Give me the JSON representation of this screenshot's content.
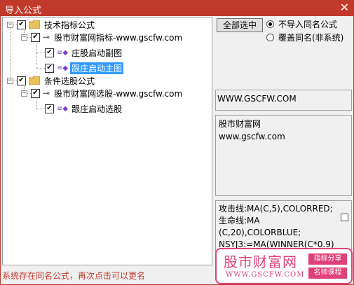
{
  "window": {
    "title": "导入公式",
    "close_glyph": "✕"
  },
  "tree": {
    "group1": {
      "label": "技术指标公式",
      "checked": true
    },
    "group1_child": {
      "label": "股市财富网指标-www.gscfw.com"
    },
    "group1_item1": {
      "label": "庄股启动副图"
    },
    "group1_item2": {
      "label": "跟庄启动主图"
    },
    "group2": {
      "label": "条件选股公式"
    },
    "group2_child": {
      "label": "股市财富网选股-www.gscfw.com"
    },
    "group2_item1": {
      "label": "跟庄启动选股"
    },
    "expander_glyph": "−",
    "check_glyph": "✔"
  },
  "options": {
    "select_all_label": "全部选中",
    "radio_no_import": "不导入同名公式",
    "radio_overwrite": "覆盖同名(非系统)"
  },
  "info": {
    "url": "WWW.GSCFW.COM",
    "desc_line1": "股市财富网",
    "desc_line2": "www.gscfw.com",
    "code_lines": [
      "攻击线:MA(C,5),COLORRED;",
      "生命线:MA",
      "(C,20),COLORBLUE;",
      "NSYJ3:=MA(WINNER(C*0.9)"
    ]
  },
  "status": {
    "text": "系统存在同名公式，再次点击可以更名"
  },
  "watermark": {
    "brand": "股市财富网",
    "site": "WWW.GSCFW.COM",
    "tag1": "指标分享",
    "tag2": "名师课程"
  }
}
